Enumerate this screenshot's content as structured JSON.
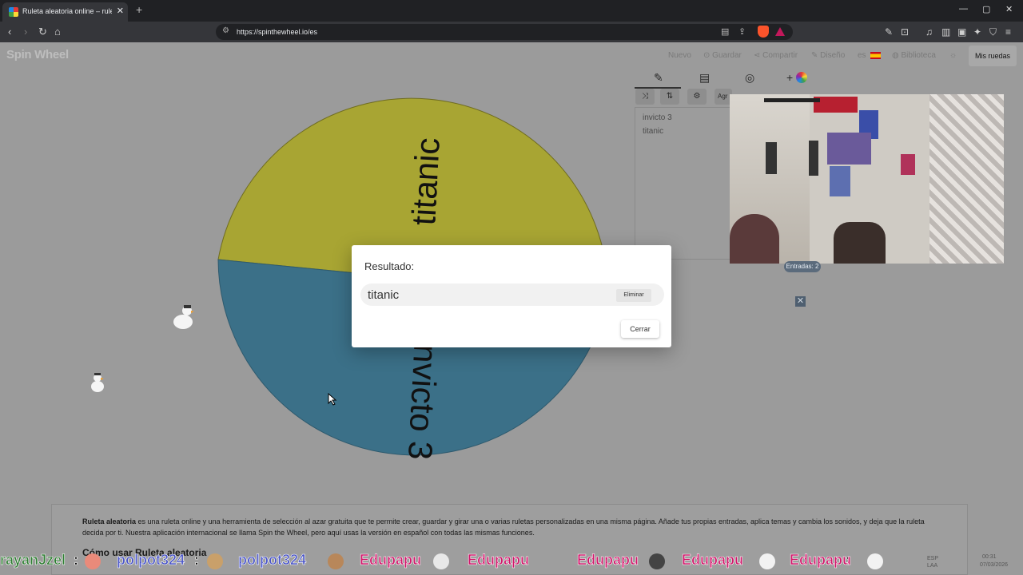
{
  "browser": {
    "tab_title": "Ruleta aleatoria online – ruleta d",
    "tab_close": "✕",
    "new_tab": "+",
    "url": "https://spinthewheel.io/es",
    "window_controls": [
      "—",
      "▢",
      "✕"
    ]
  },
  "site": {
    "logo": "Spin Wheel",
    "nav": {
      "nuevo": "Nuevo",
      "guardar": "Guardar",
      "compartir": "Compartir",
      "diseno": "Diseño",
      "lang": "es",
      "biblioteca": "Biblioteca",
      "mis_ruedas": "Mis ruedas"
    }
  },
  "wheel": {
    "segments": [
      {
        "label": "titanic",
        "color": "#a8a533"
      },
      {
        "label": "invicto 3",
        "color": "#3b7088"
      }
    ]
  },
  "panel": {
    "add_label": "Agr",
    "entries": [
      "invicto 3",
      "titanic"
    ],
    "count_label": "Entradas: 2"
  },
  "modal": {
    "title": "Resultado:",
    "result": "titanic",
    "delete_label": "Eliminar",
    "close_label": "Cerrar"
  },
  "description": {
    "strong": "Ruleta aleatoria",
    "text": " es una ruleta online y una herramienta de selección al azar gratuita que te permite crear, guardar y girar una o varias ruletas personalizadas en una misma página. Añade tus propias entradas, aplica temas y cambia los sonidos, y deja que la ruleta decida por ti. Nuestra aplicación internacional se llama Spin the Wheel, pero aquí usas la versión en español con todas las mismas funciones.",
    "heading": "Cómo usar Ruleta aleatoria"
  },
  "chat": {
    "names": [
      "rayanJzel",
      "polpot324",
      "polpot324",
      "Edupapu",
      "Edupapu",
      "Edupapu",
      "Edupapu",
      "Edupapu"
    ],
    "separator": ":"
  },
  "taskbar": {
    "lang": "ESP",
    "lang2": "LAA",
    "time": "00:31",
    "date": "07/03/2026"
  }
}
